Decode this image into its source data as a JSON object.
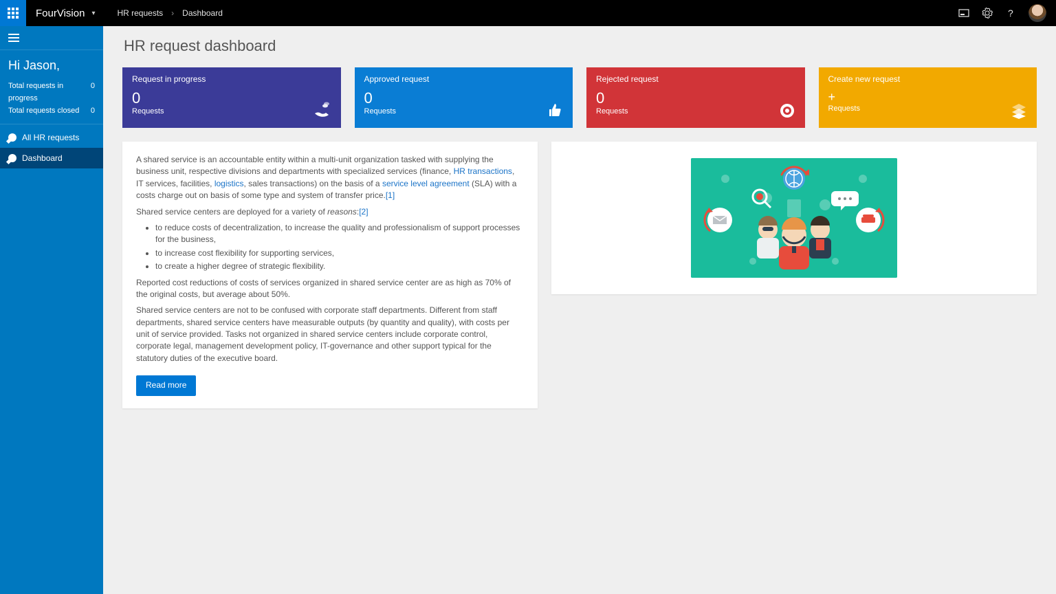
{
  "topbar": {
    "brand": "FourVision",
    "breadcrumbs": [
      "HR requests",
      "Dashboard"
    ]
  },
  "sidebar": {
    "greeting": "Hi Jason,",
    "stats": [
      {
        "label": "Total requests in progress",
        "value": "0"
      },
      {
        "label": "Total requests closed",
        "value": "0"
      }
    ],
    "nav": [
      {
        "label": "All HR requests",
        "active": false
      },
      {
        "label": "Dashboard",
        "active": true
      }
    ]
  },
  "page": {
    "title": "HR request dashboard"
  },
  "tiles": {
    "in_progress": {
      "title": "Request in progress",
      "value": "0",
      "label": "Requests"
    },
    "approved": {
      "title": "Approved request",
      "value": "0",
      "label": "Requests"
    },
    "rejected": {
      "title": "Rejected request",
      "value": "0",
      "label": "Requests"
    },
    "create": {
      "title": "Create new request",
      "plus": "+",
      "label": "Requests"
    }
  },
  "article": {
    "p1a": "A shared service is an accountable entity within a multi-unit organization tasked with supplying the business unit, respective divisions and departments with specialized services (finance, ",
    "link_hr": "HR transactions",
    "p1b": ", IT services, facilities, ",
    "link_logistics": "logistics",
    "p1c": ", sales transactions) on the basis of a ",
    "link_sla": "service level agreement",
    "p1d": " (SLA) with a costs charge out on basis of some type and system of transfer price.",
    "ref1": "[1]",
    "p2a": "Shared service centers are deployed for a variety of ",
    "p2_em": "reasons",
    "ref2": "[2]",
    "bullets": [
      "to reduce costs of decentralization, to increase the quality and professionalism of support processes for the business,",
      "to increase cost flexibility for supporting services,",
      "to create a higher degree of strategic flexibility."
    ],
    "p3": "Reported cost reductions of costs of services organized in shared service center are as high as 70% of the original costs, but average about 50%.",
    "p4": "Shared service centers are not to be confused with corporate staff departments. Different from staff departments, shared service centers have measurable outputs (by quantity and quality), with costs per unit of service provided. Tasks not organized in shared service centers include corporate control, corporate legal, management development policy, IT-governance and other support typical for the statutory duties of the executive board.",
    "read_more": "Read more"
  }
}
